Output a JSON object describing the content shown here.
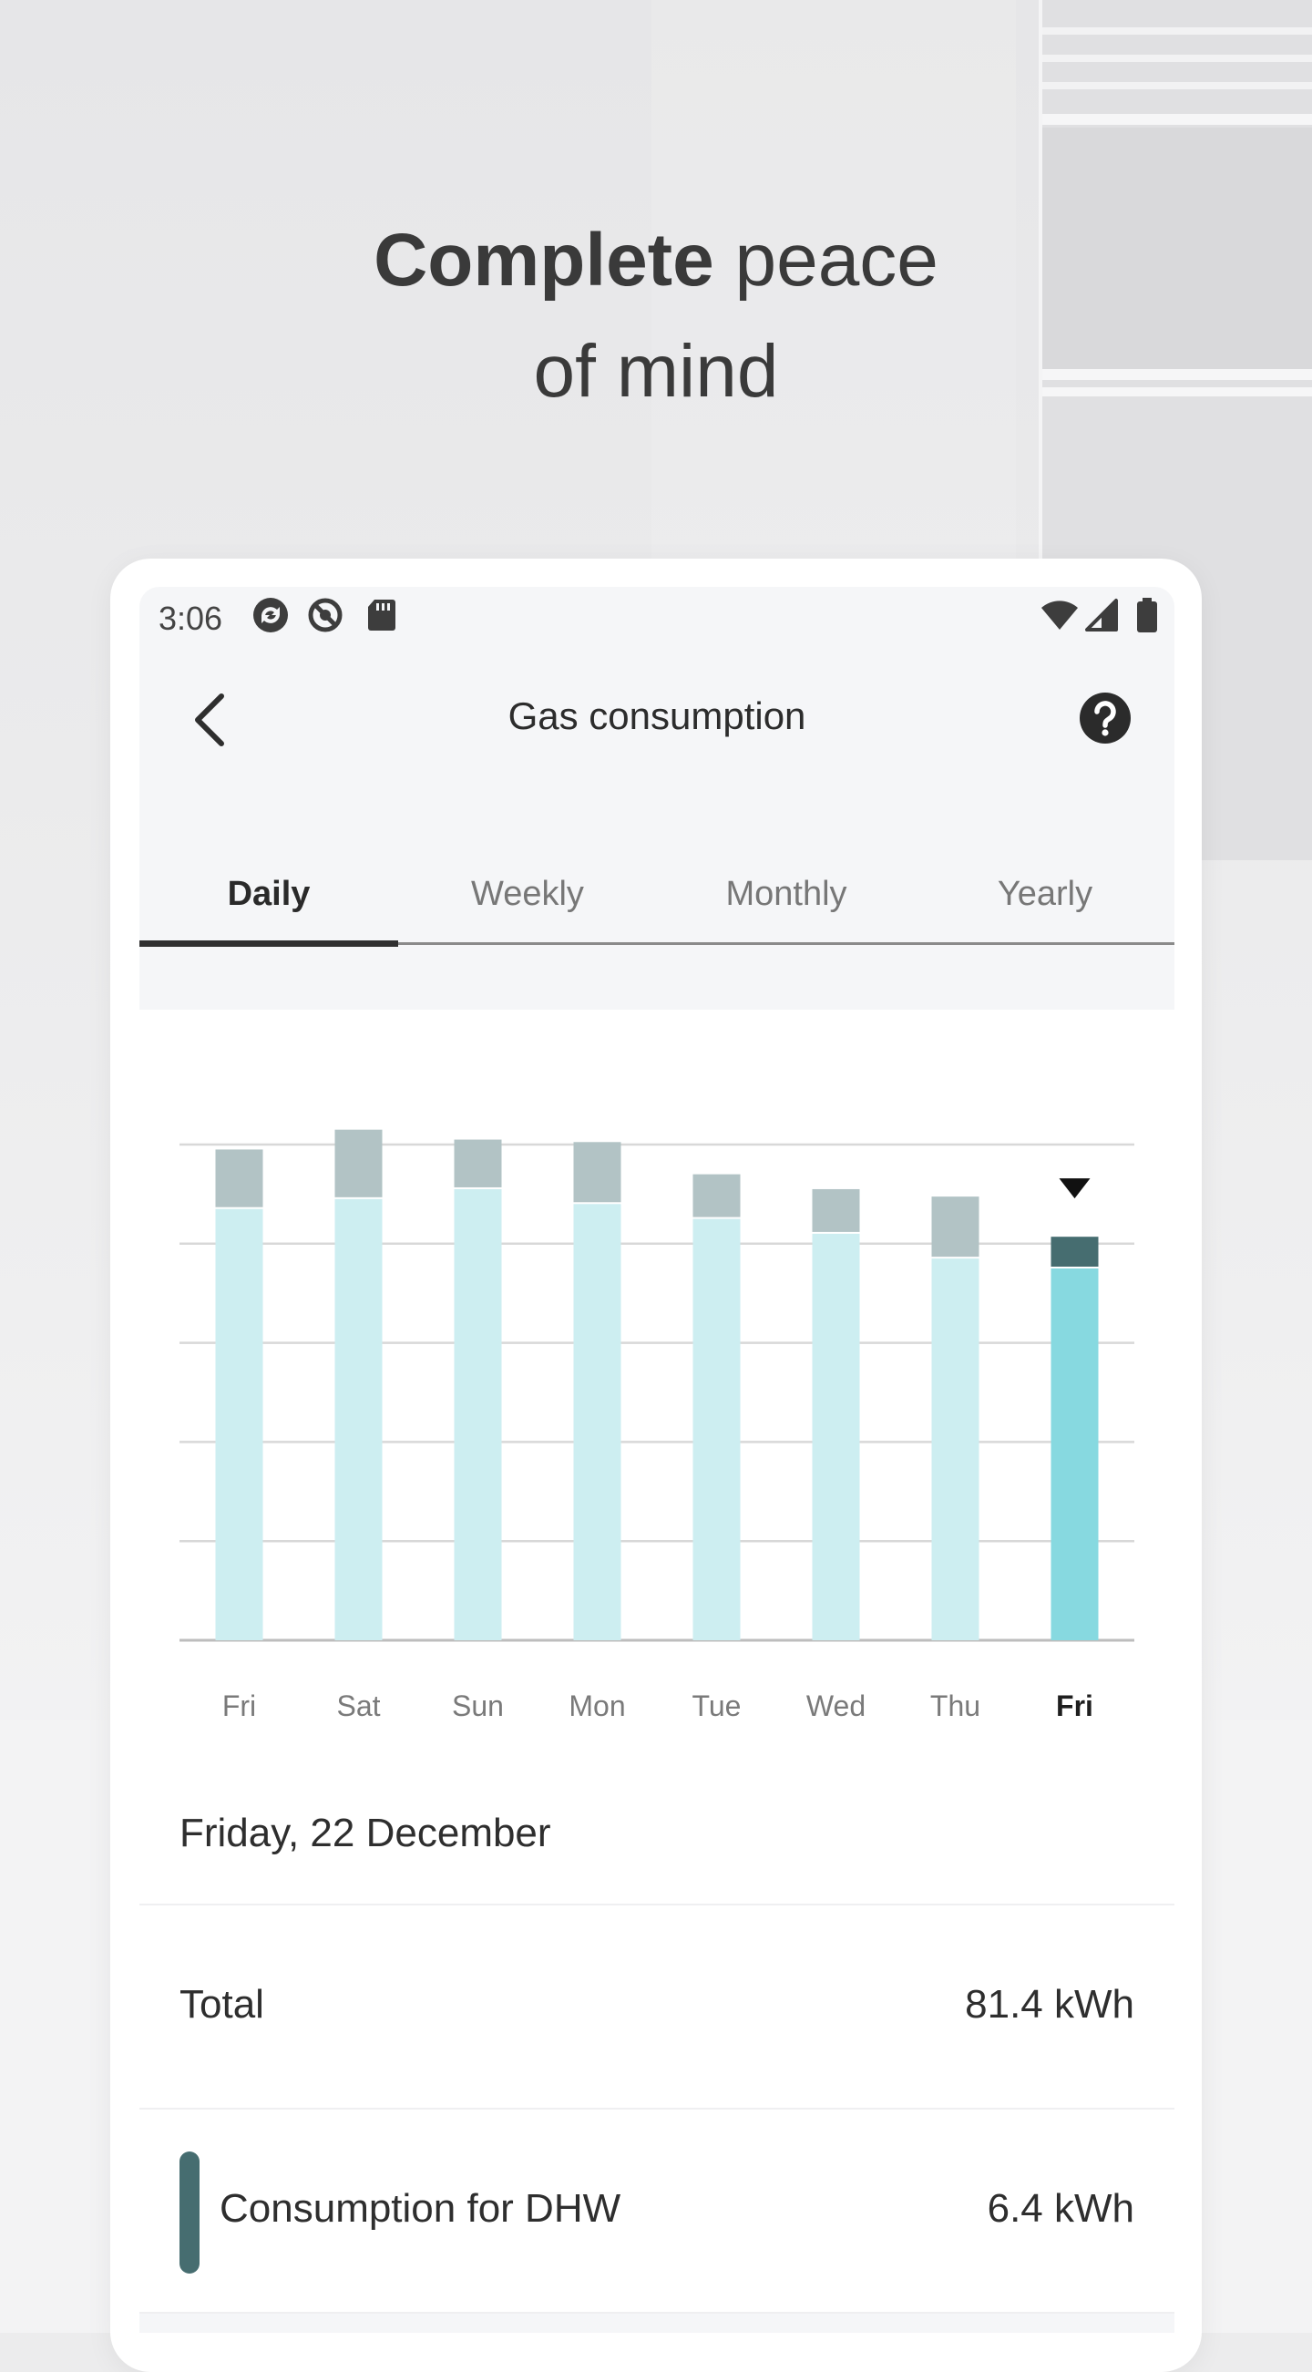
{
  "headline": {
    "bold": "Complete",
    "rest_line1": " peace",
    "line2": "of mind"
  },
  "status_bar": {
    "time": "3:06",
    "left_icons": [
      "sync-icon",
      "blocked-icon",
      "sd-card-icon"
    ],
    "right_icons": [
      "wifi-icon",
      "signal-icon",
      "battery-icon"
    ]
  },
  "app_bar": {
    "title": "Gas consumption",
    "back_icon": "chevron-left-icon",
    "help_icon": "help-circle-icon"
  },
  "tabs": [
    {
      "label": "Daily",
      "active": true
    },
    {
      "label": "Weekly",
      "active": false
    },
    {
      "label": "Monthly",
      "active": false
    },
    {
      "label": "Yearly",
      "active": false
    }
  ],
  "chart_data": {
    "type": "bar",
    "stacked": true,
    "categories": [
      "Fri",
      "Sat",
      "Sun",
      "Mon",
      "Tue",
      "Wed",
      "Thu",
      "Fri"
    ],
    "selected_index": 7,
    "series": [
      {
        "values": [
          87,
          89,
          91,
          88,
          85,
          82,
          77,
          75
        ]
      },
      {
        "values": [
          12,
          14,
          10,
          12.5,
          9,
          9,
          12.5,
          6.4
        ]
      }
    ],
    "ylim": [
      0,
      100
    ],
    "gridlines": 6,
    "colors": {
      "base": "#cdeef1",
      "top": "#b2c3c5",
      "base_selected": "#87d9e0",
      "top_selected": "#466d70",
      "grid": "#d8d8d8",
      "axis": "#bdbdbd"
    }
  },
  "detail": {
    "date": "Friday, 22 December",
    "total_label": "Total",
    "total_value": "81.4 kWh",
    "dhw_label": "Consumption for DHW",
    "dhw_value": "6.4 kWh",
    "dhw_color": "#466d70"
  }
}
